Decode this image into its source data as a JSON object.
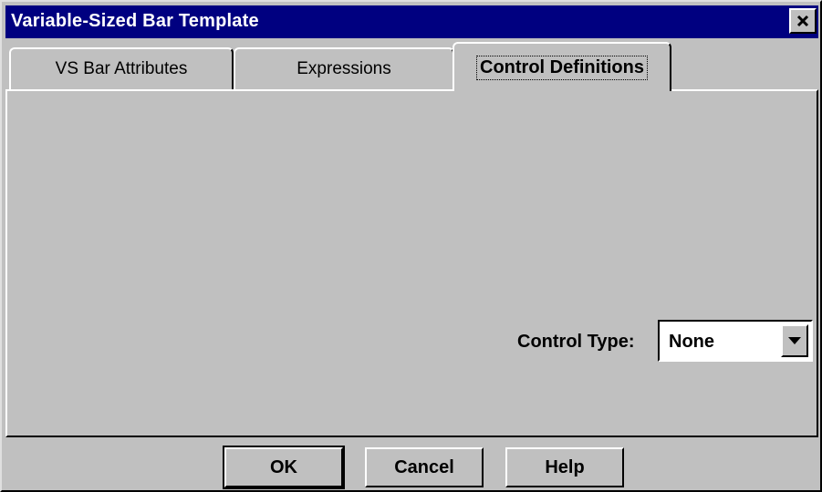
{
  "window": {
    "title": "Variable-Sized Bar Template",
    "close_icon": "close-icon"
  },
  "tabs": [
    {
      "label": "VS Bar Attributes",
      "selected": false
    },
    {
      "label": "Expressions",
      "selected": false
    },
    {
      "label": "Control Definitions",
      "selected": true
    }
  ],
  "control": {
    "label": "Control Type:",
    "value": "None",
    "dropdown_icon": "chevron-down-icon"
  },
  "buttons": {
    "ok": "OK",
    "cancel": "Cancel",
    "help": "Help"
  },
  "colors": {
    "titlebar": "#000080",
    "face": "#c0c0c0"
  }
}
